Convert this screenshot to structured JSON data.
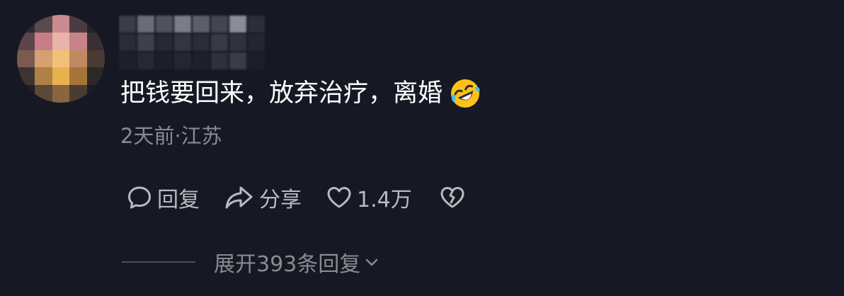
{
  "comment": {
    "text": "把钱要回来，放弃治疗，离婚",
    "emoji": "rolling-on-floor-laughing",
    "meta": "2天前·江苏"
  },
  "actions": {
    "reply_label": "回复",
    "share_label": "分享",
    "like_count": "1.4万"
  },
  "replies": {
    "expand_label": "展开393条回复"
  },
  "colors": {
    "background": "#161823",
    "primary_text": "#ffffff",
    "secondary_text": "#8a8b91",
    "action_text": "#b9bac0"
  }
}
